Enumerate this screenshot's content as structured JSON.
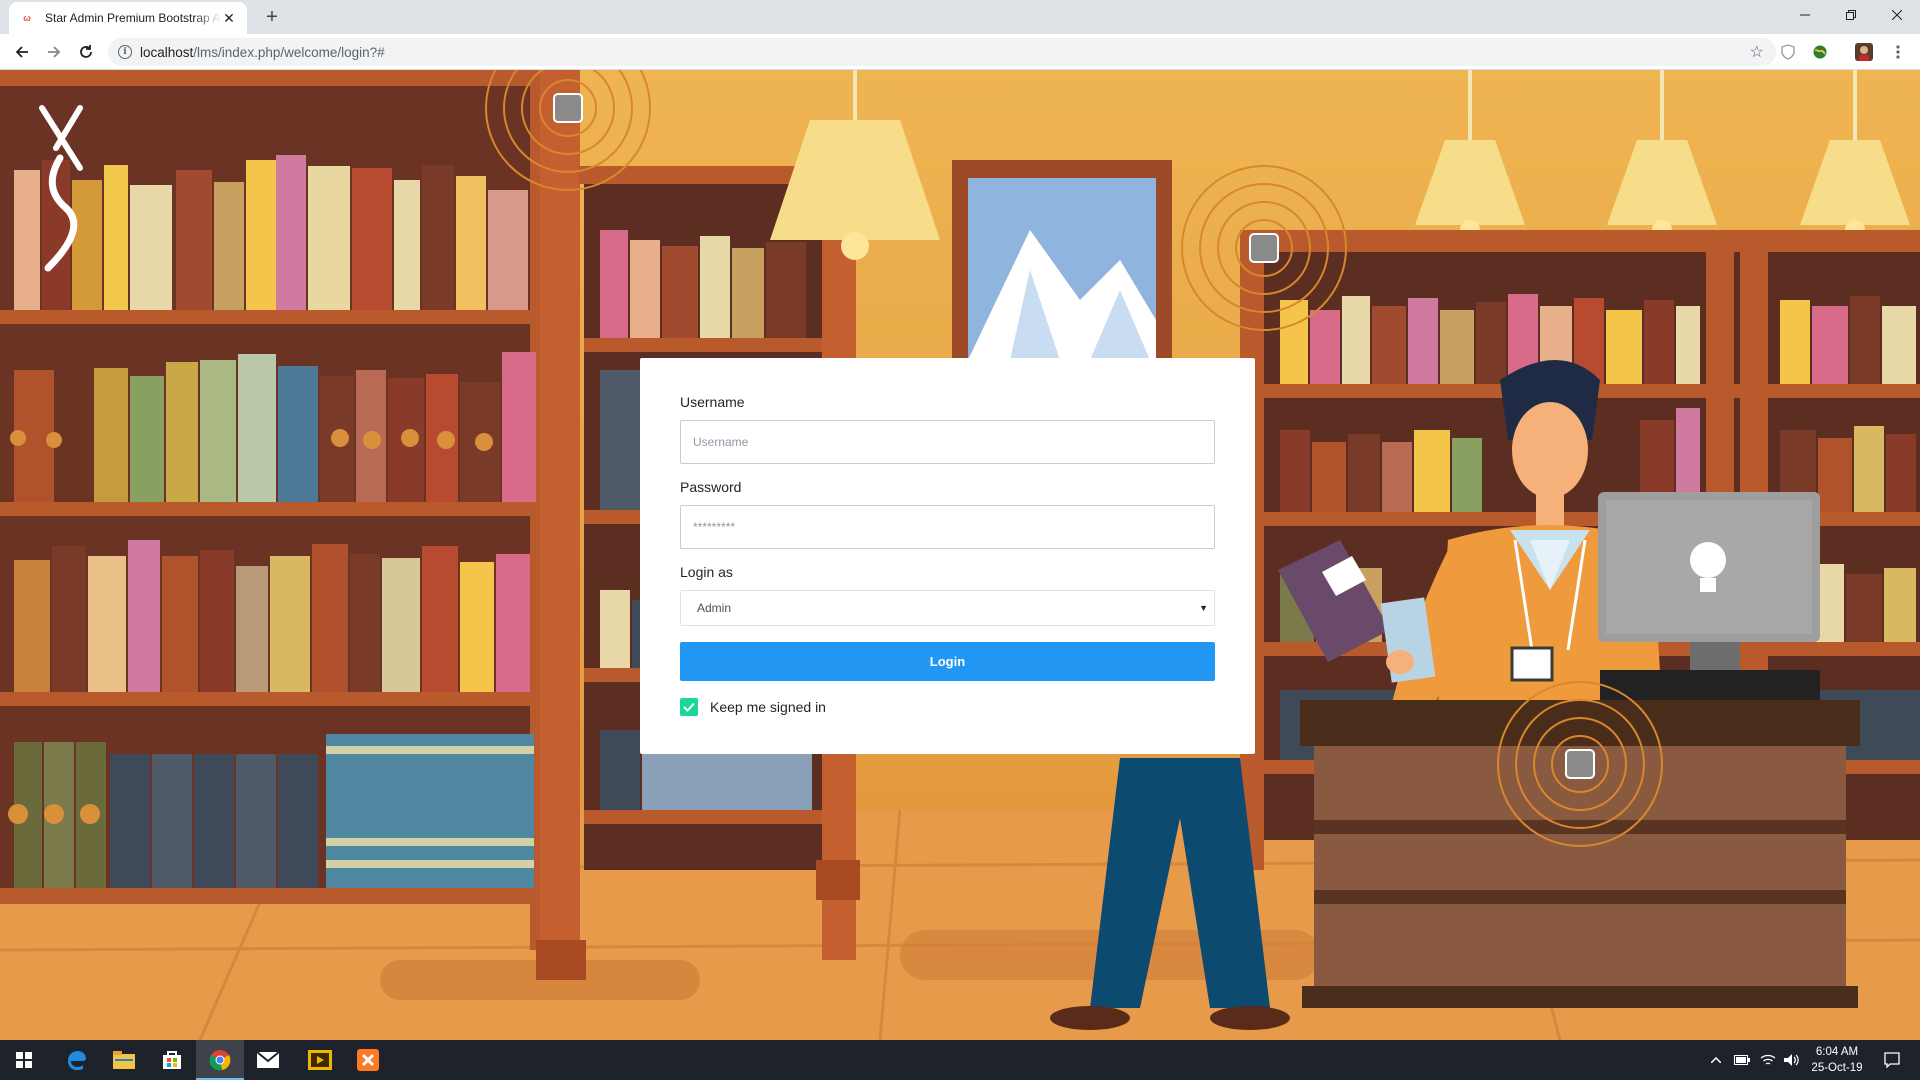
{
  "browser": {
    "tab_title": "Star Admin Premium Bootstrap Admin Dashboard Template",
    "tab_favicon_text": "ω",
    "new_tab_symbol": "+",
    "url_host": "localhost",
    "url_path": "/lms/index.php/welcome/login?#"
  },
  "login": {
    "username_label": "Username",
    "username_placeholder": "Username",
    "password_label": "Password",
    "password_placeholder": "*********",
    "login_as_label": "Login as",
    "login_as_selected": "Admin",
    "login_button": "Login",
    "keep_signed_in_label": "Keep me signed in",
    "keep_signed_in_checked": true
  },
  "taskbar": {
    "time": "6:04 AM",
    "date": "25-Oct-19"
  },
  "colors": {
    "primary_button": "#2196f3",
    "checkbox_green": "#19d895",
    "background_orange": "#e9a949"
  },
  "icons": [
    "info-icon",
    "star-icon",
    "back-arrow-icon",
    "forward-arrow-icon",
    "reload-icon",
    "windows-start-icon",
    "edge-icon",
    "file-explorer-icon",
    "store-icon",
    "chrome-icon",
    "mail-icon",
    "media-icon",
    "xampp-icon",
    "notification-icon"
  ]
}
